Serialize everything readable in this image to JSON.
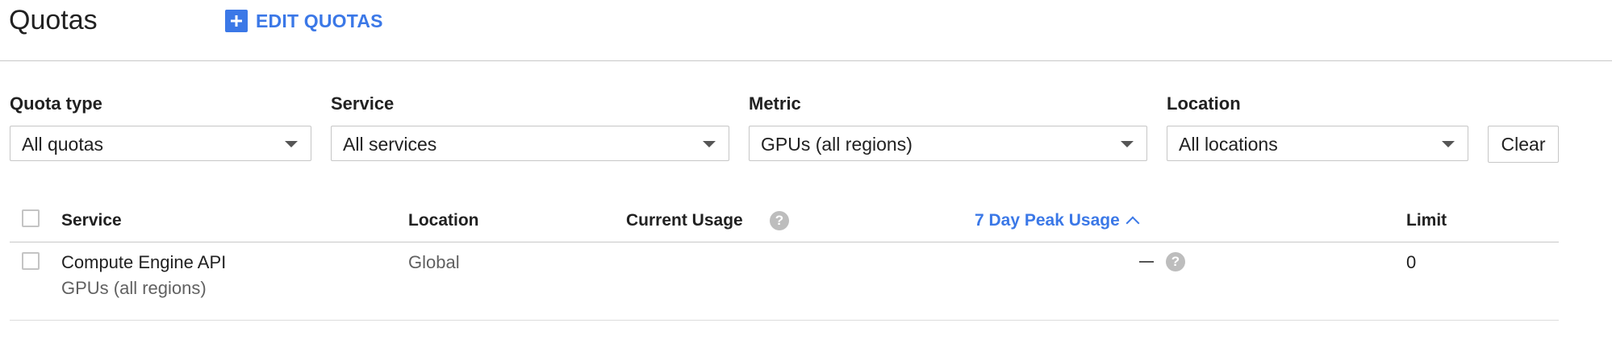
{
  "header": {
    "title": "Quotas",
    "edit_quotas_label": "EDIT QUOTAS",
    "edit_icon": "plus-icon"
  },
  "filters": {
    "quota_type": {
      "label": "Quota type",
      "value": "All quotas"
    },
    "service": {
      "label": "Service",
      "value": "All services"
    },
    "metric": {
      "label": "Metric",
      "value": "GPUs (all regions)"
    },
    "location": {
      "label": "Location",
      "value": "All locations"
    },
    "clear_label": "Clear"
  },
  "table": {
    "columns": {
      "service": "Service",
      "location": "Location",
      "current_usage": "Current Usage",
      "peak_usage": "7 Day Peak Usage",
      "limit": "Limit"
    },
    "sort": {
      "column": "peak_usage",
      "direction": "ascending"
    },
    "rows": [
      {
        "service": "Compute Engine API",
        "metric": "GPUs (all regions)",
        "location": "Global",
        "current_usage": "",
        "peak_usage": "—",
        "limit": "0"
      }
    ]
  },
  "colors": {
    "accent": "#3b78e7",
    "text": "#212121",
    "muted_text": "#616161",
    "border": "#c6c6c6",
    "help_icon": "#bdbdbd"
  }
}
